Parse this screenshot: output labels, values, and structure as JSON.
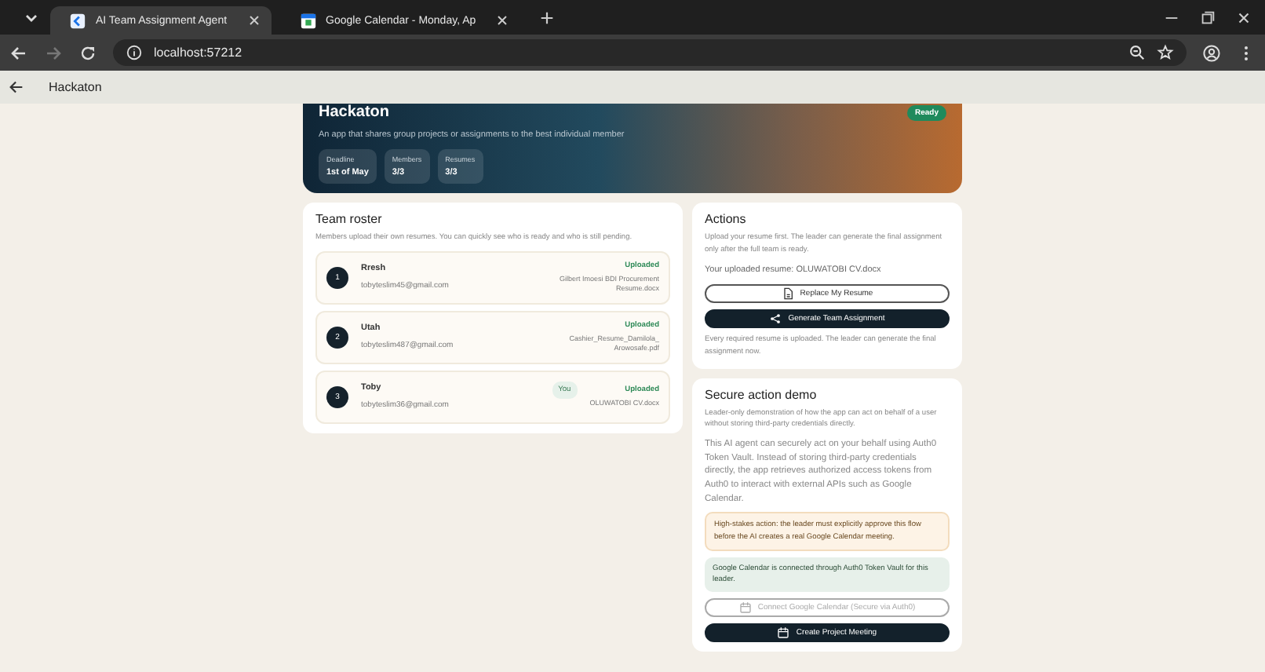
{
  "browser": {
    "tabs": [
      {
        "title": "AI Team Assignment Agent",
        "selected": true
      },
      {
        "title": "Google Calendar - Monday, Ap",
        "selected": false
      }
    ],
    "address": "localhost:57212",
    "forward_disabled": true
  },
  "app_bar": {
    "title": "Hackaton"
  },
  "hero": {
    "title": "Hackaton",
    "status": "Ready",
    "description": "An app that shares group projects or assignments to the best individual member",
    "stats": [
      {
        "label": "Deadline",
        "value": "1st of May"
      },
      {
        "label": "Members",
        "value": "3/3"
      },
      {
        "label": "Resumes",
        "value": "3/3"
      }
    ]
  },
  "roster": {
    "title": "Team roster",
    "subtitle": "Members upload their own resumes. You can quickly see who is ready and who is still pending.",
    "members": [
      {
        "number": "1",
        "name": "Rresh",
        "email": "tobyteslim45@gmail.com",
        "status": "Uploaded",
        "file": "Gilbert Imoesi BDI Procurement Resume.docx"
      },
      {
        "number": "2",
        "name": "Utah",
        "email": "tobyteslim487@gmail.com",
        "status": "Uploaded",
        "file": "Cashier_Resume_Damilola_ Arowosafe.pdf"
      },
      {
        "number": "3",
        "name": "Toby",
        "email": "tobyteslim36@gmail.com",
        "status": "Uploaded",
        "file": "OLUWATOBI CV.docx",
        "badge": "You"
      }
    ]
  },
  "actions": {
    "title": "Actions",
    "intro": "Upload your resume first. The leader can generate the final assignment only after the full team is ready.",
    "resume": "Your uploaded resume: OLUWATOBI CV.docx",
    "buttons": [
      {
        "label": "Replace My Resume",
        "kind": "outline",
        "disabled": false
      },
      {
        "label": "Generate Team Assignment",
        "kind": "primary",
        "disabled": false
      }
    ],
    "note": "Every required resume is uploaded. The leader can generate the final assignment now."
  },
  "secure": {
    "title": "Secure action demo",
    "subtitle": "Leader-only demonstration of how the app can act on behalf of a user without storing third-party credentials directly.",
    "body": "This AI agent can securely act on your behalf using Auth0 Token Vault. Instead of storing third-party credentials directly, the app retrieves authorized access tokens from Auth0 to interact with external APIs such as Google Calendar.",
    "notices": [
      {
        "kind": "warning",
        "text": "High-stakes action: the leader must explicitly approve this flow before the AI creates a real Google Calendar meeting."
      },
      {
        "kind": "success",
        "text": "Google Calendar is connected through Auth0 Token Vault for this leader."
      }
    ],
    "buttons": [
      {
        "label": "Connect Google Calendar (Secure via Auth0)",
        "kind": "outline",
        "disabled": true
      },
      {
        "label": "Create Project Meeting",
        "kind": "primary",
        "disabled": false
      }
    ]
  }
}
